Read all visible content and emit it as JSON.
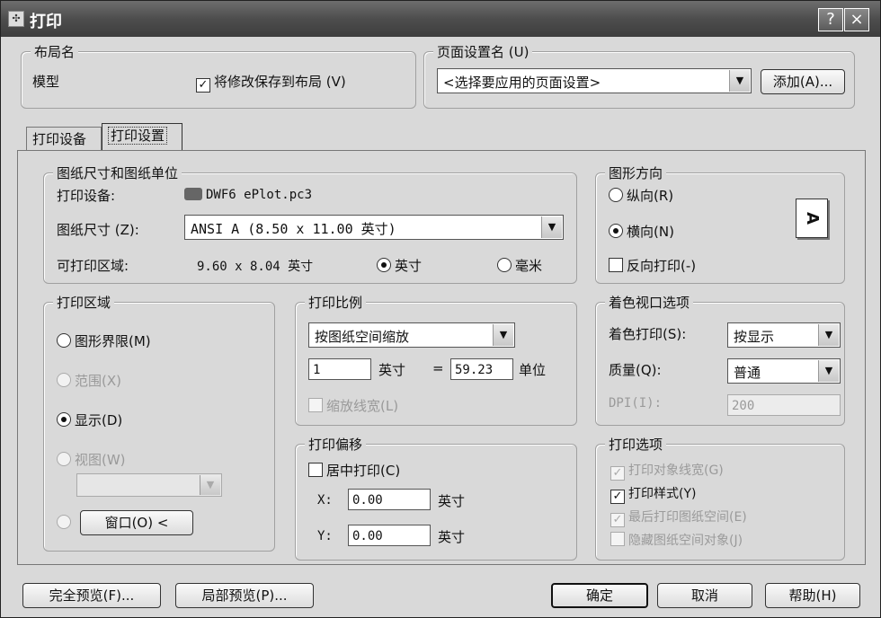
{
  "window": {
    "title": "打印",
    "help_label": "?",
    "close_label": "×"
  },
  "layout_name": {
    "group_label": "布局名",
    "value": "模型",
    "save_checkbox_label": "将修改保存到布局 (V)",
    "save_checked": true
  },
  "page_setup": {
    "group_label": "页面设置名 (U)",
    "selected": "<选择要应用的页面设置>",
    "add_button": "添加(A)..."
  },
  "tabs": [
    {
      "label": "打印设备"
    },
    {
      "label": "打印设置"
    }
  ],
  "paper": {
    "group_label": "图纸尺寸和图纸单位",
    "device_label": "打印设备:",
    "device_value": "DWF6 ePlot.pc3",
    "size_label": "图纸尺寸 (Z):",
    "size_value": "ANSI A (8.50 x 11.00 英寸)",
    "printable_label": "可打印区域:",
    "printable_value": "9.60 x 8.04 英寸",
    "unit_inch": "英寸",
    "unit_mm": "毫米"
  },
  "orientation": {
    "group_label": "图形方向",
    "portrait": "纵向(R)",
    "landscape": "横向(N)",
    "reverse": "反向打印(-)",
    "preview_letter": "A"
  },
  "plot_area": {
    "group_label": "打印区域",
    "limits": "图形界限(M)",
    "extents": "范围(X)",
    "display": "显示(D)",
    "view": "视图(W)",
    "window_button": "窗口(O) <"
  },
  "plot_scale": {
    "group_label": "打印比例",
    "mode": "按图纸空间缩放",
    "value1": "1",
    "unit1": "英寸",
    "equals": "=",
    "value2": "59.23",
    "unit2": "单位",
    "scale_lineweights": "缩放线宽(L)"
  },
  "plot_offset": {
    "group_label": "打印偏移",
    "center": "居中打印(C)",
    "x_label": "X:",
    "x_value": "0.00",
    "x_unit": "英寸",
    "y_label": "Y:",
    "y_value": "0.00",
    "y_unit": "英寸"
  },
  "shade": {
    "group_label": "着色视口选项",
    "shade_label": "着色打印(S):",
    "shade_value": "按显示",
    "quality_label": "质量(Q):",
    "quality_value": "普通",
    "dpi_label": "DPI(I):",
    "dpi_value": "200"
  },
  "options": {
    "group_label": "打印选项",
    "items": [
      {
        "label": "打印对象线宽(G)",
        "checked": true,
        "disabled": true
      },
      {
        "label": "打印样式(Y)",
        "checked": true,
        "disabled": false
      },
      {
        "label": "最后打印图纸空间(E)",
        "checked": true,
        "disabled": true
      },
      {
        "label": "隐藏图纸空间对象(J)",
        "checked": false,
        "disabled": true
      }
    ]
  },
  "footer": {
    "full_preview": "完全预览(F)...",
    "partial_preview": "局部预览(P)...",
    "ok": "确定",
    "cancel": "取消",
    "help": "帮助(H)"
  }
}
